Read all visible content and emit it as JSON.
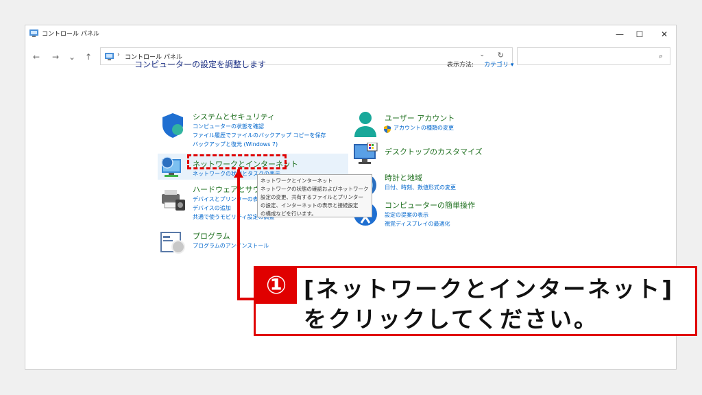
{
  "window": {
    "title": "コントロール パネル"
  },
  "window_controls": {
    "minimize": "—",
    "maximize": "☐",
    "close": "✕"
  },
  "nav": {
    "back": "←",
    "forward": "→",
    "recent": "⌄",
    "up": "↑"
  },
  "address": {
    "separator": "›",
    "path": "コントロール パネル",
    "dropdown": "⌄",
    "refresh": "↻"
  },
  "search": {
    "placeholder": "",
    "icon": "⌕"
  },
  "main": {
    "heading": "コンピューターの設定を調整します",
    "view_by_label": "表示方法:",
    "view_by_value": "カテゴリ ▾"
  },
  "categories_left": [
    {
      "title": "システムとセキュリティ",
      "links": [
        "コンピューターの状態を確認",
        "ファイル履歴でファイルのバックアップ コピーを保存",
        "バックアップと復元 (Windows 7)"
      ]
    },
    {
      "title": "ネットワークとインターネット",
      "links": [
        "ネットワークの状態とタスクの表示"
      ]
    },
    {
      "title": "ハードウェアとサウンド",
      "links": [
        "デバイスとプリンターの表示",
        "デバイスの追加",
        "共通で使うモビリティ設定の調整"
      ]
    },
    {
      "title": "プログラム",
      "links": [
        "プログラムのアンインストール"
      ]
    }
  ],
  "categories_right": [
    {
      "title": "ユーザー アカウント",
      "links": [
        "アカウントの種類の変更"
      ]
    },
    {
      "title": "デスクトップのカスタマイズ",
      "links": []
    },
    {
      "title": "時計と地域",
      "links": [
        "日付、時刻、数値形式の変更"
      ]
    },
    {
      "title": "コンピューターの簡単操作",
      "links": [
        "設定の提案の表示",
        "視覚ディスプレイの最適化"
      ]
    }
  ],
  "tooltip": {
    "lines": [
      "ネットワークとインターネット",
      "ネットワークの状態の確認およびネットワーク",
      "設定の変更、共有するファイルとプリンター",
      "の設定、インターネットの表示と接続設定",
      "の構成などを行います。"
    ]
  },
  "callout": {
    "number": "①",
    "line1": "[ネットワークとインターネット]",
    "line2": "をクリックしてください。"
  },
  "colors": {
    "accent_red": "#e00000",
    "link_blue": "#0066cc",
    "title_green": "#1e6f1e",
    "heading_blue": "#1e3287"
  }
}
